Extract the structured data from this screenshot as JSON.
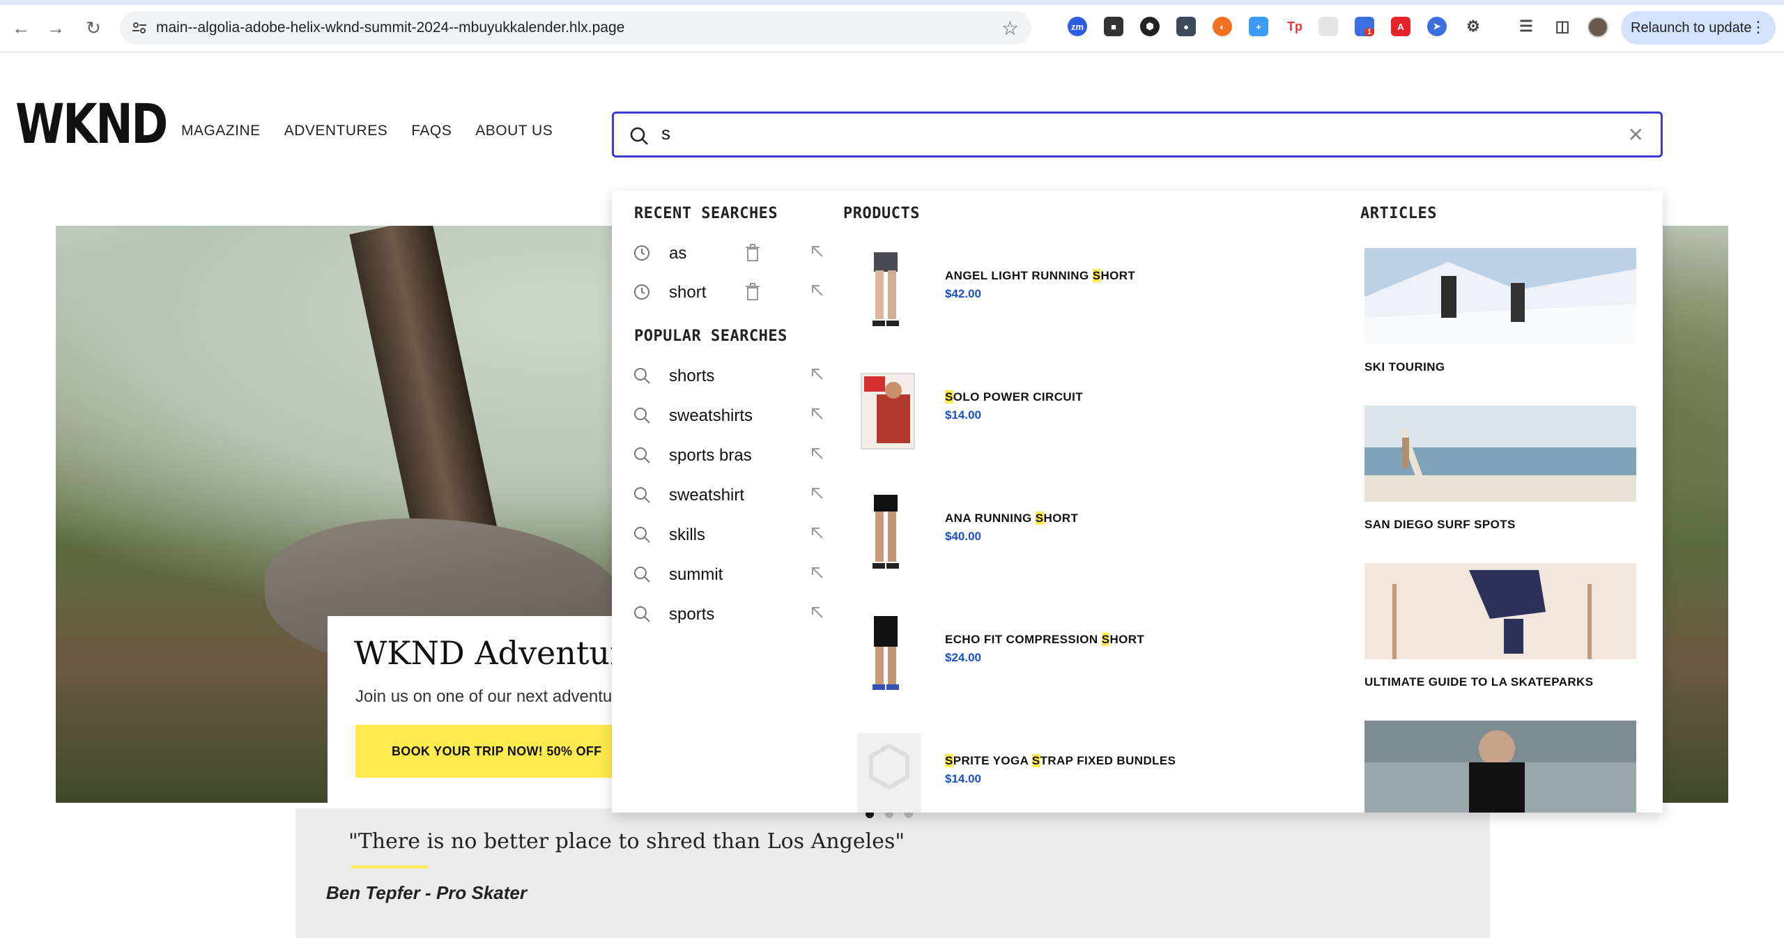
{
  "browser": {
    "url": "main--algolia-adobe-helix-wknd-summit-2024--mbuyukkalender.hlx.page",
    "relaunch_label": "Relaunch to update",
    "extension_badge": "1"
  },
  "site": {
    "logo": "WKND",
    "nav": [
      "MAGAZINE",
      "ADVENTURES",
      "FAQS",
      "ABOUT US"
    ]
  },
  "search": {
    "value": "s"
  },
  "dropdown": {
    "recent_title": "RECENT SEARCHES",
    "recent": [
      "as",
      "short"
    ],
    "popular_title": "POPULAR SEARCHES",
    "popular": [
      "shorts",
      "sweatshirts",
      "sports bras",
      "sweatshirt",
      "skills",
      "summit",
      "sports"
    ],
    "products_title": "PRODUCTS",
    "products": [
      {
        "pre": "ANGEL LIGHT RUNNING ",
        "hl": "S",
        "post": "HORT",
        "price": "$42.00"
      },
      {
        "pre": "",
        "hl": "S",
        "post": "OLO POWER CIRCUIT",
        "price": "$14.00"
      },
      {
        "pre": "ANA RUNNING ",
        "hl": "S",
        "post": "HORT",
        "price": "$40.00"
      },
      {
        "pre": "ECHO FIT COMPRESSION ",
        "hl": "S",
        "post": "HORT",
        "price": "$24.00"
      },
      {
        "pre": "",
        "hl": "S",
        "post": "PRITE YOGA ",
        "hl2": "S",
        "post2": "TRAP FIXED BUNDLES",
        "price": "$14.00"
      }
    ],
    "articles_title": "ARTICLES",
    "articles": [
      "SKI TOURING",
      "SAN DIEGO SURF SPOTS",
      "ULTIMATE GUIDE TO LA SKATEPARKS"
    ]
  },
  "hero": {
    "title": "WKND Adventures",
    "subtitle": "Join us on one of our next adventures",
    "cta": "BOOK YOUR TRIP NOW! 50% OFF"
  },
  "quote": {
    "text": "\"There is no better place to shred than Los Angeles\"",
    "author": "Ben Tepfer - Pro Skater"
  },
  "colors": {
    "accent_yellow": "#ffea4f",
    "focus_blue": "#3b3bd4",
    "price_blue": "#1b50c9"
  }
}
